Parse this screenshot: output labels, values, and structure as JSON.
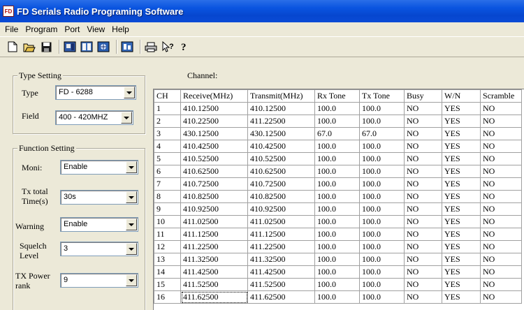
{
  "window": {
    "icon_text": "FD",
    "title": "FD Serials Radio Programing Software"
  },
  "menu": [
    "File",
    "Program",
    "Port",
    "View",
    "Help"
  ],
  "toolbar": [
    "new-icon",
    "open-icon",
    "save-icon",
    "read-radio-icon",
    "write-radio-icon",
    "radio-info-icon",
    "settings-icon",
    "print-icon",
    "context-help-icon",
    "about-icon"
  ],
  "type_setting": {
    "legend": "Type Setting",
    "type_label": "Type",
    "type_value": "FD - 6288",
    "field_label": "Field",
    "field_value": "400 - 420MHZ"
  },
  "function_setting": {
    "legend": "Function Setting",
    "moni_label": "Moni:",
    "moni_value": "Enable",
    "tx_total_label_1": "Tx total",
    "tx_total_label_2": "Time(s)",
    "tx_total_value": "30s",
    "warning_label": "Warning",
    "warning_value": "Enable",
    "squelch_label_1": "Squelch",
    "squelch_label_2": "Level",
    "squelch_value": "3",
    "tx_power_label_1": "TX Power",
    "tx_power_label_2": "rank",
    "tx_power_value": "9"
  },
  "channel": {
    "label": "Channel:",
    "columns": [
      "CH",
      "Receive(MHz)",
      "Transmit(MHz)",
      "Rx Tone",
      "Tx Tone",
      "Busy",
      "W/N",
      "Scramble"
    ],
    "rows": [
      [
        "1",
        "410.12500",
        "410.12500",
        "100.0",
        "100.0",
        "NO",
        "YES",
        "NO"
      ],
      [
        "2",
        "410.22500",
        "411.22500",
        "100.0",
        "100.0",
        "NO",
        "YES",
        "NO"
      ],
      [
        "3",
        "430.12500",
        "430.12500",
        "67.0",
        "67.0",
        "NO",
        "YES",
        "NO"
      ],
      [
        "4",
        "410.42500",
        "410.42500",
        "100.0",
        "100.0",
        "NO",
        "YES",
        "NO"
      ],
      [
        "5",
        "410.52500",
        "410.52500",
        "100.0",
        "100.0",
        "NO",
        "YES",
        "NO"
      ],
      [
        "6",
        "410.62500",
        "410.62500",
        "100.0",
        "100.0",
        "NO",
        "YES",
        "NO"
      ],
      [
        "7",
        "410.72500",
        "410.72500",
        "100.0",
        "100.0",
        "NO",
        "YES",
        "NO"
      ],
      [
        "8",
        "410.82500",
        "410.82500",
        "100.0",
        "100.0",
        "NO",
        "YES",
        "NO"
      ],
      [
        "9",
        "410.92500",
        "410.92500",
        "100.0",
        "100.0",
        "NO",
        "YES",
        "NO"
      ],
      [
        "10",
        "411.02500",
        "411.02500",
        "100.0",
        "100.0",
        "NO",
        "YES",
        "NO"
      ],
      [
        "11",
        "411.12500",
        "411.12500",
        "100.0",
        "100.0",
        "NO",
        "YES",
        "NO"
      ],
      [
        "12",
        "411.22500",
        "411.22500",
        "100.0",
        "100.0",
        "NO",
        "YES",
        "NO"
      ],
      [
        "13",
        "411.32500",
        "411.32500",
        "100.0",
        "100.0",
        "NO",
        "YES",
        "NO"
      ],
      [
        "14",
        "411.42500",
        "411.42500",
        "100.0",
        "100.0",
        "NO",
        "YES",
        "NO"
      ],
      [
        "15",
        "411.52500",
        "411.52500",
        "100.0",
        "100.0",
        "NO",
        "YES",
        "NO"
      ],
      [
        "16",
        "411.62500",
        "411.62500",
        "100.0",
        "100.0",
        "NO",
        "YES",
        "NO"
      ]
    ]
  }
}
